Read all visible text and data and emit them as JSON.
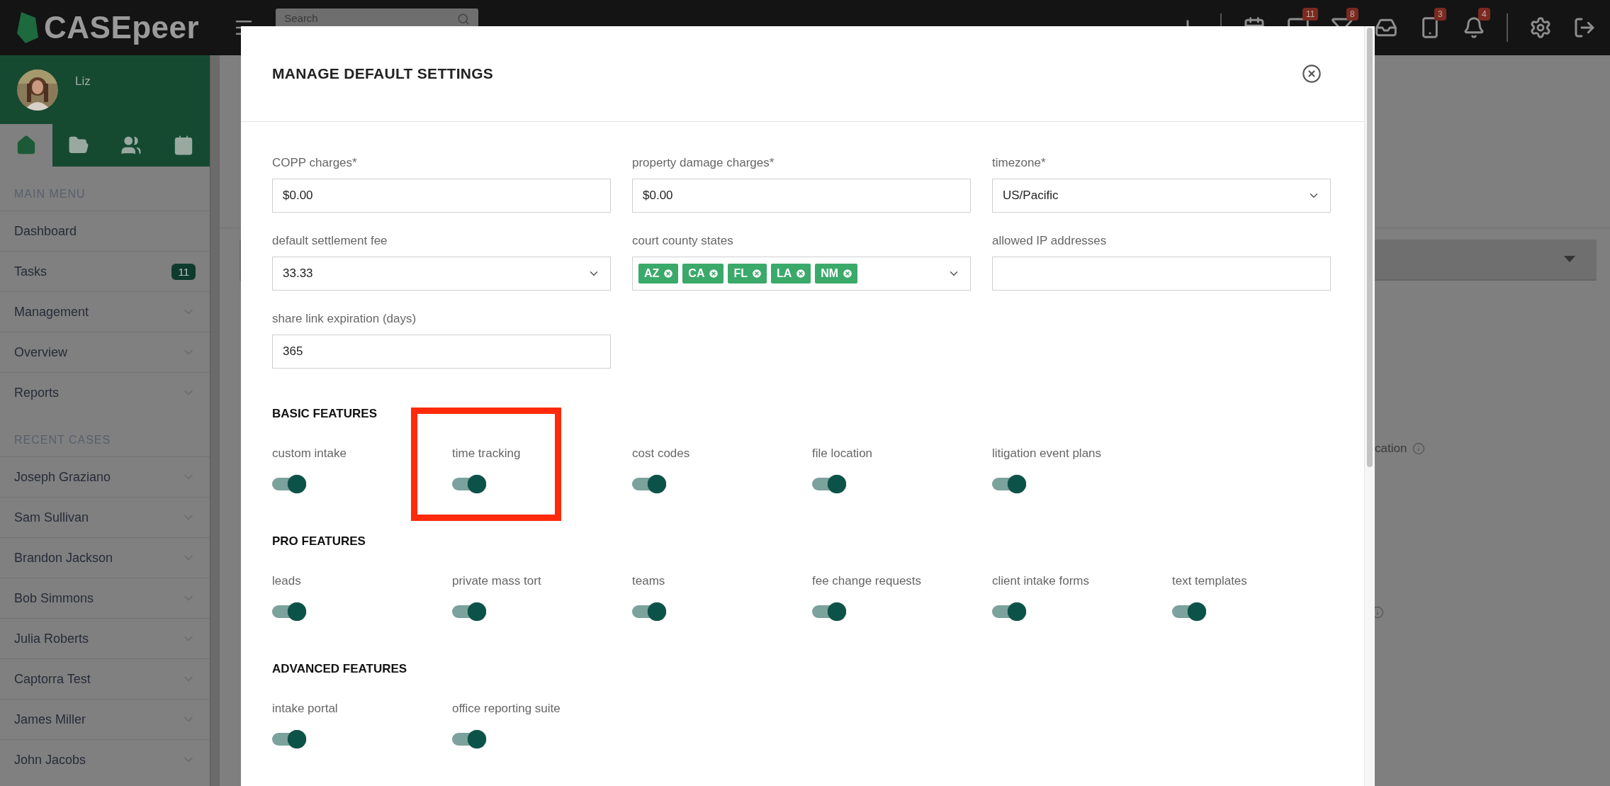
{
  "top_bar": {
    "logo": "CASEpeer",
    "search": {
      "placeholder": "Search"
    },
    "icons": [
      {
        "kind": "plus"
      },
      {
        "kind": "divider"
      },
      {
        "kind": "calendar"
      },
      {
        "kind": "chat",
        "badge": "11"
      },
      {
        "kind": "filter",
        "badge": "8"
      },
      {
        "kind": "inbox"
      },
      {
        "kind": "phone",
        "badge": "3"
      },
      {
        "kind": "bell",
        "badge": "4"
      },
      {
        "kind": "divider"
      },
      {
        "kind": "settings"
      },
      {
        "kind": "logout"
      }
    ]
  },
  "sidebar": {
    "user": "Liz",
    "tabs": [
      {
        "kind": "home",
        "selected": true
      },
      {
        "kind": "folder",
        "selected": false
      },
      {
        "kind": "users",
        "selected": false
      },
      {
        "kind": "calendar",
        "selected": false
      }
    ],
    "sections": [
      {
        "heading": "MAIN MENU",
        "items": [
          {
            "label": "Dashboard",
            "expandable": false
          },
          {
            "label": "Tasks",
            "expandable": false,
            "badge": "11"
          },
          {
            "label": "Management",
            "expandable": true
          },
          {
            "label": "Overview",
            "expandable": true
          },
          {
            "label": "Reports",
            "expandable": true
          }
        ]
      },
      {
        "heading": "RECENT CASES",
        "items": [
          {
            "label": "Joseph Graziano",
            "expandable": true
          },
          {
            "label": "Sam Sullivan",
            "expandable": true
          },
          {
            "label": "Brandon Jackson",
            "expandable": true
          },
          {
            "label": "Bob Simmons",
            "expandable": true
          },
          {
            "label": "Julia Roberts",
            "expandable": true
          },
          {
            "label": "Captorra Test",
            "expandable": true
          },
          {
            "label": "James Miller",
            "expandable": true
          },
          {
            "label": "John Jacobs",
            "expandable": true
          }
        ]
      }
    ]
  },
  "background": {
    "partial_label": "cation"
  },
  "modal": {
    "title": "MANAGE DEFAULT SETTINGS",
    "fields": [
      {
        "kind": "text",
        "label": "COPP charges*",
        "value": "$0.00"
      },
      {
        "kind": "text",
        "label": "property damage charges*",
        "value": "$0.00"
      },
      {
        "kind": "select",
        "label": "timezone*",
        "value": "US/Pacific"
      },
      {
        "kind": "select",
        "label": "default settlement fee",
        "value": "33.33"
      },
      {
        "kind": "tags",
        "label": "court county states",
        "tags": [
          "AZ",
          "CA",
          "FL",
          "LA",
          "NM"
        ]
      },
      {
        "kind": "text",
        "label": "allowed IP addresses"
      },
      {
        "kind": "text",
        "label": "share link expiration (days)",
        "value": "365"
      }
    ],
    "feature_groups": [
      {
        "title": "BASIC FEATURES",
        "features": [
          {
            "label": "custom intake",
            "on": true,
            "highlighted": false
          },
          {
            "label": "time tracking",
            "on": true,
            "highlighted": true
          },
          {
            "label": "cost codes",
            "on": true,
            "highlighted": false
          },
          {
            "label": "file location",
            "on": true,
            "highlighted": false
          },
          {
            "label": "litigation event plans",
            "on": true,
            "highlighted": false
          }
        ]
      },
      {
        "title": "PRO FEATURES",
        "features": [
          {
            "label": "leads",
            "on": true,
            "highlighted": false
          },
          {
            "label": "private mass tort",
            "on": true,
            "highlighted": false
          },
          {
            "label": "teams",
            "on": true,
            "highlighted": false
          },
          {
            "label": "fee change requests",
            "on": true,
            "highlighted": false
          },
          {
            "label": "client intake forms",
            "on": true,
            "highlighted": false
          },
          {
            "label": "text templates",
            "on": true,
            "highlighted": false
          }
        ]
      },
      {
        "title": "ADVANCED FEATURES",
        "features": [
          {
            "label": "intake portal",
            "on": true,
            "highlighted": false
          },
          {
            "label": "office reporting suite",
            "on": true,
            "highlighted": false
          }
        ]
      }
    ]
  }
}
